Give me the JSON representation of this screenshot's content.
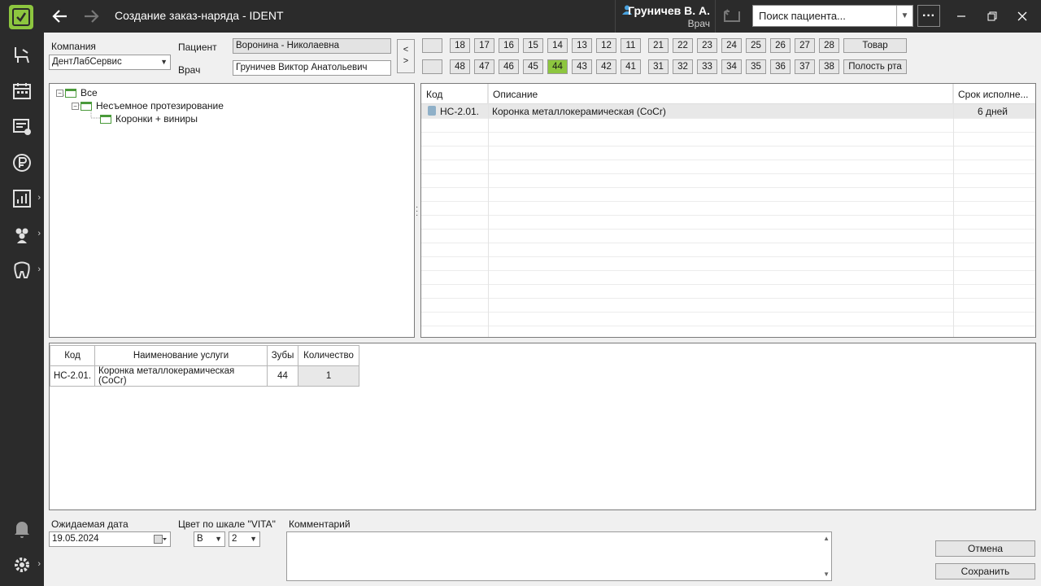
{
  "window": {
    "title": "Создание заказ-наряда - IDENT",
    "user_name": "Груничев В. А.",
    "user_role": "Врач",
    "search_placeholder": "Поиск пациента...",
    "more_label": "···"
  },
  "form": {
    "company_label": "Компания",
    "company_value": "ДентЛабСервис",
    "patient_label": "Пациент",
    "patient_value": "Воронина - Николаевна",
    "doctor_label": "Врач",
    "doctor_value": "Груничев Виктор Анатольевич",
    "arrow_up": "<",
    "arrow_down": ">"
  },
  "teeth": {
    "upper": [
      "18",
      "17",
      "16",
      "15",
      "14",
      "13",
      "12",
      "11",
      "21",
      "22",
      "23",
      "24",
      "25",
      "26",
      "27",
      "28"
    ],
    "lower": [
      "48",
      "47",
      "46",
      "45",
      "44",
      "43",
      "42",
      "41",
      "31",
      "32",
      "33",
      "34",
      "35",
      "36",
      "37",
      "38"
    ],
    "selected": "44",
    "goods_label": "Товар",
    "mouth_label": "Полость рта"
  },
  "tree": {
    "items": [
      {
        "label": "Все"
      },
      {
        "label": "Несъемное протезирование"
      },
      {
        "label": "Коронки + виниры"
      }
    ]
  },
  "services_grid": {
    "headers": [
      "Код",
      "Описание",
      "Срок исполне..."
    ],
    "rows": [
      {
        "code": "НС-2.01.",
        "desc": "Коронка металлокерамическая (CoCr)",
        "term": "6 дней"
      }
    ]
  },
  "order_table": {
    "headers": [
      "Код",
      "Наименование услуги",
      "Зубы",
      "Количество"
    ],
    "rows": [
      {
        "code": "НС-2.01.",
        "name": "Коронка металлокерамическая (CoCr)",
        "teeth": "44",
        "qty": "1"
      }
    ]
  },
  "bottom": {
    "date_label": "Ожидаемая дата",
    "date_value": "19.05.2024",
    "vita_label": "Цвет по шкале \"VITA\"",
    "vita_letter": "B",
    "vita_number": "2",
    "comment_label": "Комментарий",
    "cancel_label": "Отмена",
    "save_label": "Сохранить"
  },
  "colors": {
    "sidebar_bg": "#2b2b2b",
    "accent": "#8dc63f"
  }
}
